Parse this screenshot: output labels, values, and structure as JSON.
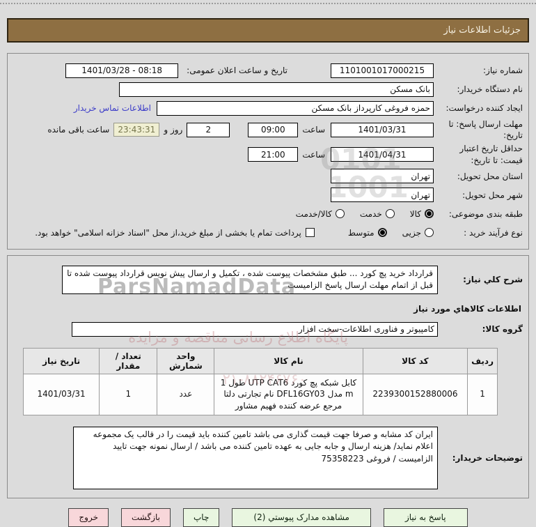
{
  "title_bar": "جزئیات اطلاعات نیاز",
  "form": {
    "need_number": {
      "label": "شماره نیاز:",
      "value": "1101001017000215"
    },
    "announce": {
      "label": "تاریخ و ساعت اعلان عمومی:",
      "value": "08:18 - 1401/03/28"
    },
    "buyer_org": {
      "label": "نام دستگاه خریدار:",
      "value": "بانک مسکن"
    },
    "creator": {
      "label": "ایجاد کننده درخواست:",
      "value": "حمزه فروغی کارپرداز بانک مسکن",
      "contact_link": "اطلاعات تماس خریدار"
    },
    "reply_deadline": {
      "label": "مهلت ارسال پاسخ: تا تاریخ:",
      "date": "1401/03/31",
      "hour_label": "ساعت",
      "time": "09:00",
      "days_value": "2",
      "days_label": "روز و",
      "countdown": "23:43:31",
      "remain_label": "ساعت باقی مانده"
    },
    "price_validity": {
      "label": "حداقل تاریخ اعتبار قیمت: تا تاریخ:",
      "date": "1401/04/31",
      "hour_label": "ساعت",
      "time": "21:00"
    },
    "province": {
      "label": "استان محل تحویل:",
      "value": "تهران"
    },
    "city": {
      "label": "شهر محل تحویل:",
      "value": "تهران"
    },
    "subject_class": {
      "label": "طبقه بندی موضوعی:",
      "options": [
        {
          "label": "کالا",
          "selected": true
        },
        {
          "label": "خدمت",
          "selected": false
        },
        {
          "label": "کالا/خدمت",
          "selected": false
        }
      ]
    },
    "purchase_type": {
      "label": "نوع فرآیند خرید :",
      "options": [
        {
          "label": "جزیی",
          "selected": false
        },
        {
          "label": "متوسط",
          "selected": true
        }
      ],
      "treasury": {
        "checked": false,
        "label": "پرداخت تمام یا بخشی از مبلغ خرید،از محل \"اسناد خزانه اسلامی\" خواهد بود."
      }
    }
  },
  "need_section": {
    "desc_label": "شرح کلي نیاز:",
    "desc_text": "قرارداد خرید پچ کورد ...   طبق مشخصات پیوست شده ، تکمیل و ارسال پیش نویس قرارداد پیوست شده تا قبل از اتمام مهلت ارسال پاسخ الزامیست",
    "goods_header": "اطلاعات کالاهاي مورد نیاز",
    "group": {
      "label": "گروه کالا:",
      "value": "کامپیوتر و فناوری اطلاعات-سخت افزار"
    },
    "table": {
      "headers": [
        "ردیف",
        "کد کالا",
        "نام کالا",
        "واحد شمارش",
        "تعداد / مقدار",
        "تاریخ نیاز"
      ],
      "rows": [
        [
          "1",
          "2239300152880006",
          "کابل شبکه پچ کورد UTP CAT6 طول 1 m مدل DFL16GY03 نام تجارتی دلتا مرجع عرضه کننده فهیم مشاور",
          "عدد",
          "1",
          "1401/03/31"
        ]
      ]
    },
    "notes_label": "توضیحات خریدار:",
    "notes_text": "ایران کد مشابه و صرفا جهت قیمت گذاری می باشد تامین کننده باید قیمت را در قالب یک مجموعه اعلام نماید/ هزینه ارسال و جابه جایی به عهده تامین کننده می باشد / ارسال نمونه جهت تایید الزامیست / فروغی 75358223"
  },
  "buttons": {
    "reply": "پاسخ به نیاز",
    "view_docs": "مشاهده مدارک پیوستي (2)",
    "print": "چاپ",
    "back": "بازگشت",
    "exit": "خروج"
  },
  "watermarks": {
    "logo": "ParsNamadData",
    "fa_line1": "پایگاه اطلاع رسانی مناقصه و مزایده",
    "fa_line2": "۲۱-۸۸۲۴۶۷۶۰",
    "bin1": "0101",
    "bin2": "1001"
  },
  "colors": {
    "title_bar_bg": "#8e6f42",
    "page_bg": "#dcdcdc",
    "link": "#3b3bc8",
    "button_green": "#e9f6e0",
    "button_pink": "#f8d7da",
    "countdown_bg": "#f0efd2"
  }
}
